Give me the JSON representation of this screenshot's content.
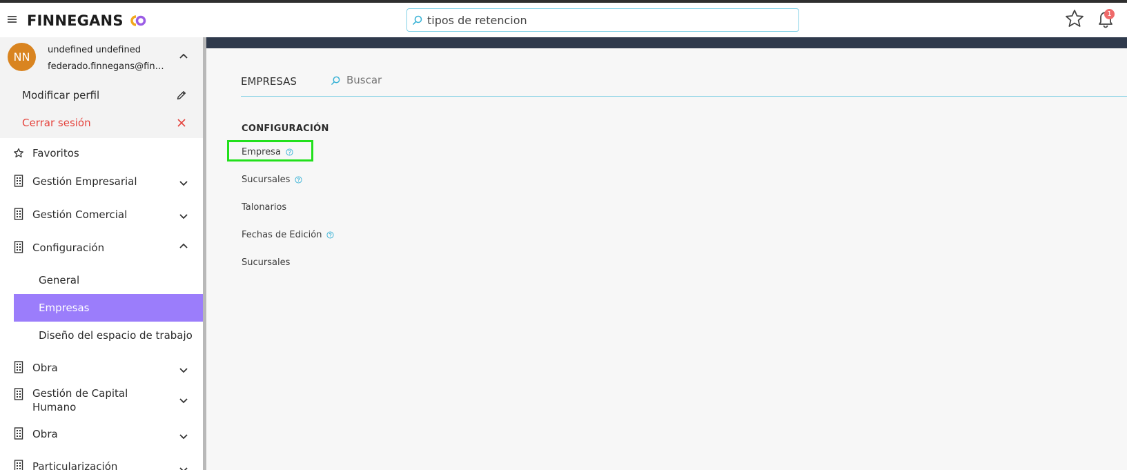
{
  "topbar": {
    "brand": "FINNEGANS",
    "search_value": "tipos de retencion",
    "notification_count": "1",
    "colors": {
      "search_border": "#7fd0e6",
      "badge": "#ef6a6a"
    }
  },
  "user": {
    "initials": "NN",
    "name": "undefined undefined",
    "email": "federado.finnegans@finnegans.com.ar",
    "edit_profile": "Modificar perfil",
    "logout": "Cerrar sesión",
    "colors": {
      "avatar": "#d98420",
      "logout": "#e5433c"
    }
  },
  "sidebar": {
    "favorites": "Favoritos",
    "items": [
      {
        "label": "Gestión Empresarial",
        "icon": "building-icon",
        "expanded": false
      },
      {
        "label": "Gestión Comercial",
        "icon": "building-icon",
        "expanded": false
      },
      {
        "label": "Configuración",
        "icon": "building-icon",
        "expanded": true
      },
      {
        "label": "Obra",
        "icon": "building-icon",
        "expanded": false
      },
      {
        "label": "Gestión de Capital Humano",
        "icon": "building-icon",
        "expanded": false
      },
      {
        "label": "Obra",
        "icon": "building-icon",
        "expanded": false
      },
      {
        "label": "Particularización",
        "icon": "building-icon",
        "expanded": false
      }
    ],
    "config_children": [
      {
        "label": "General",
        "active": false
      },
      {
        "label": "Empresas",
        "active": true
      },
      {
        "label": "Diseño del espacio de trabajo",
        "active": false
      }
    ],
    "colors": {
      "active": "#9b7dfb"
    }
  },
  "main": {
    "section_title": "EMPRESAS",
    "search_placeholder": "Buscar",
    "group_title": "CONFIGURACIÓN",
    "links": [
      {
        "label": "Empresa",
        "help": true
      },
      {
        "label": "Sucursales",
        "help": true
      },
      {
        "label": "Talonarios",
        "help": false
      },
      {
        "label": "Fechas de Edición",
        "help": true
      },
      {
        "label": "Sucursales",
        "help": false
      }
    ],
    "colors": {
      "band": "#2f3a4c",
      "highlight": "#22e01c"
    }
  }
}
